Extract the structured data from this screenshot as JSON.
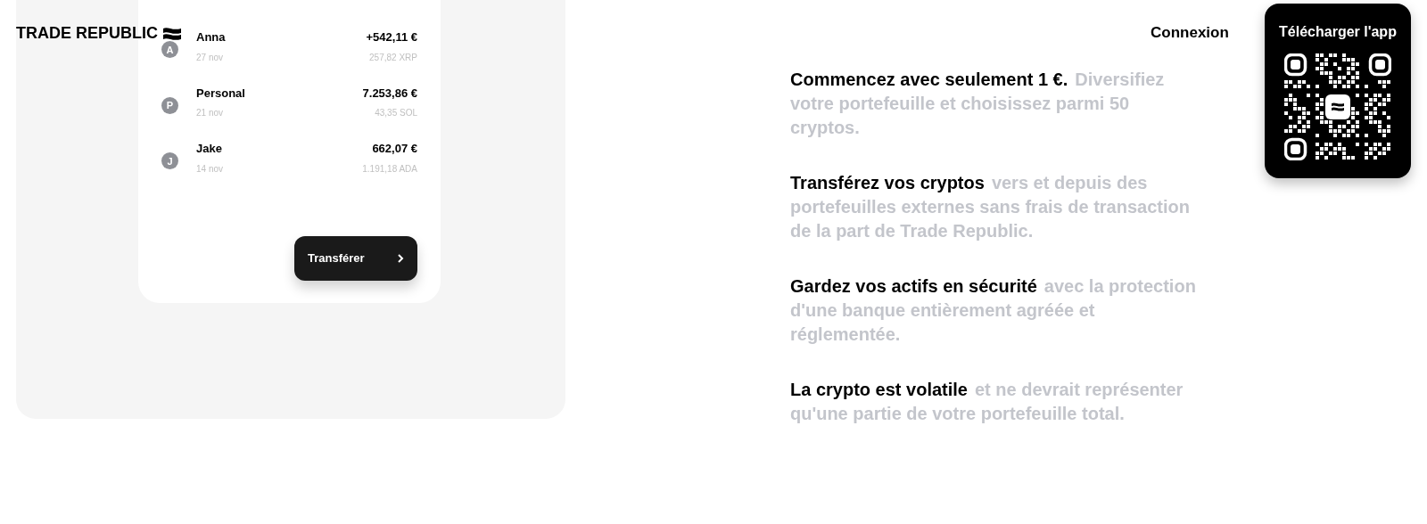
{
  "header": {
    "logo": "TRADE REPUBLIC",
    "login": "Connexion",
    "download": {
      "title": "Télécharger l'app"
    }
  },
  "transfers": [
    {
      "initial": "A",
      "name": "Anna",
      "date": "27 nov",
      "amount": "+542,11 €",
      "crypto": "257,82 XRP"
    },
    {
      "initial": "P",
      "name": "Personal",
      "date": "21 nov",
      "amount": "7.253,86 €",
      "crypto": "43,35 SOL"
    },
    {
      "initial": "J",
      "name": "Jake",
      "date": "14 nov",
      "amount": "662,07 €",
      "crypto": "1.191,18 ADA"
    }
  ],
  "transfer_button": "Transférer",
  "features": [
    {
      "lead": "Commencez avec seulement 1 €.",
      "text": "Diversifiez votre portefeuille et choisissez parmi 50 cryptos."
    },
    {
      "lead": "Transférez vos cryptos",
      "text": "vers et depuis des portefeuilles externes sans frais de transaction de la part de Trade Republic."
    },
    {
      "lead": "Gardez vos actifs en sécurité",
      "text": "avec la protection d'une banque entièrement agréée et réglementée."
    },
    {
      "lead": "La crypto est volatile",
      "text": "et ne devrait représenter qu'une partie de votre portefeuille total."
    }
  ]
}
